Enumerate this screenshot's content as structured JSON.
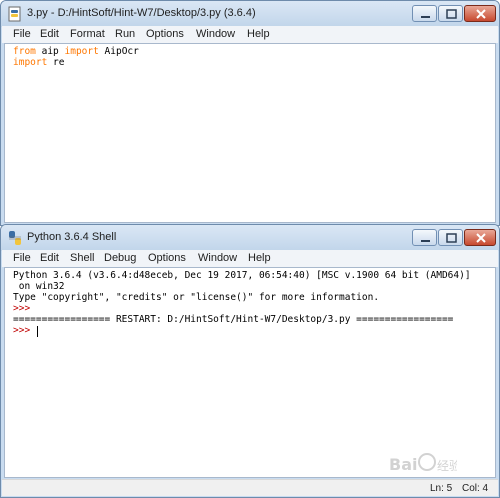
{
  "editor_window": {
    "title": "3.py - D:/HintSoft/Hint-W7/Desktop/3.py (3.6.4)",
    "menu": [
      "File",
      "Edit",
      "Format",
      "Run",
      "Options",
      "Window",
      "Help"
    ],
    "code": [
      {
        "keyword": "from",
        "rest_a": " aip ",
        "keyword2": "import",
        "rest_b": " AipOcr"
      },
      {
        "keyword": "import",
        "rest_a": " re"
      }
    ]
  },
  "shell_window": {
    "title": "Python 3.6.4 Shell",
    "menu": [
      "File",
      "Edit",
      "Shell",
      "Debug",
      "Options",
      "Window",
      "Help"
    ],
    "lines": [
      "Python 3.6.4 (v3.6.4:d48eceb, Dec 19 2017, 06:54:40) [MSC v.1900 64 bit (AMD64)]",
      " on win32",
      "Type \"copyright\", \"credits\" or \"license()\" for more information.",
      ">>> ",
      "================= RESTART: D:/HintSoft/Hint-W7/Desktop/3.py ================="
    ],
    "prompt": ">>> ",
    "status": {
      "line": "Ln: 5",
      "col": "Col: 4"
    }
  },
  "icons": {
    "app_icon": "python-file-icon",
    "minimize": "minimize-icon",
    "maximize": "maximize-icon",
    "close": "close-icon"
  },
  "colors": {
    "keyword": "#ff7700",
    "prompt": "#c00000",
    "close_button": "#c7492f"
  },
  "watermark": {
    "text": "Bai 经验"
  }
}
